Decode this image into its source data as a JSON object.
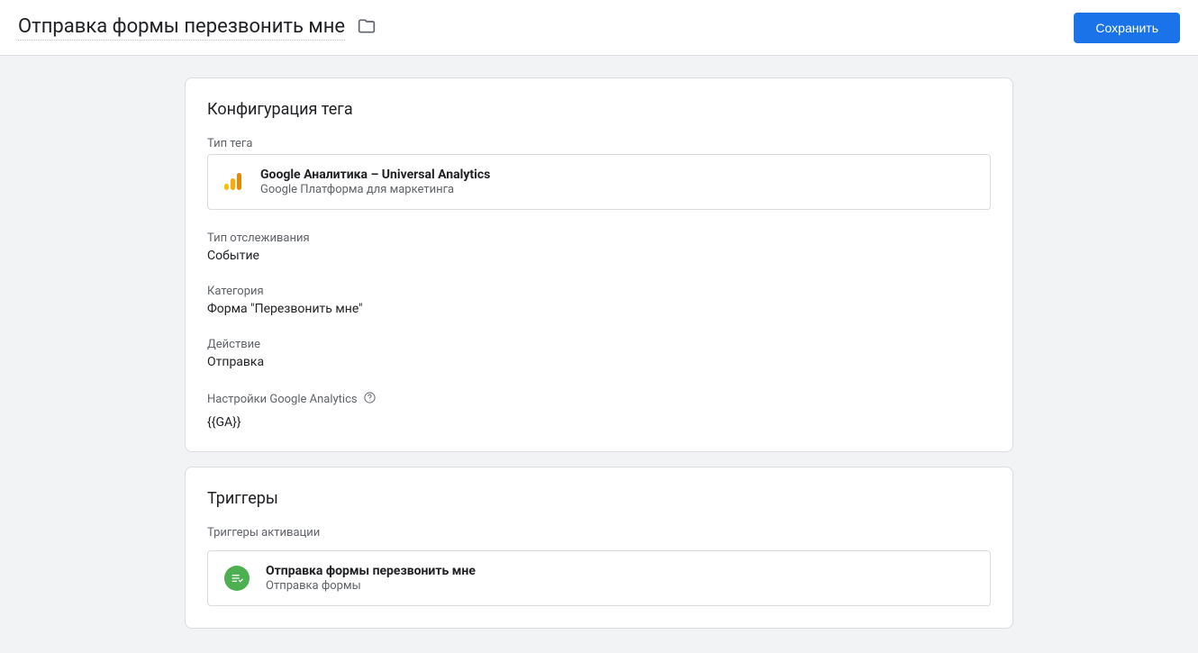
{
  "header": {
    "title": "Отправка формы перезвонить мне",
    "save_label": "Сохранить"
  },
  "tag_config": {
    "card_title": "Конфигурация тега",
    "type_label": "Тип тега",
    "type": {
      "title": "Google Аналитика – Universal Analytics",
      "subtitle": "Google Платформа для маркетинга"
    },
    "tracking_type_label": "Тип отслеживания",
    "tracking_type_value": "Событие",
    "category_label": "Категория",
    "category_value": "Форма \"Перезвонить мне\"",
    "action_label": "Действие",
    "action_value": "Отправка",
    "ga_settings_label": "Настройки Google Analytics",
    "ga_settings_value": "{{GA}}"
  },
  "triggers": {
    "card_title": "Триггеры",
    "activation_label": "Триггеры активации",
    "items": [
      {
        "title": "Отправка формы перезвонить мне",
        "subtitle": "Отправка формы"
      }
    ]
  }
}
